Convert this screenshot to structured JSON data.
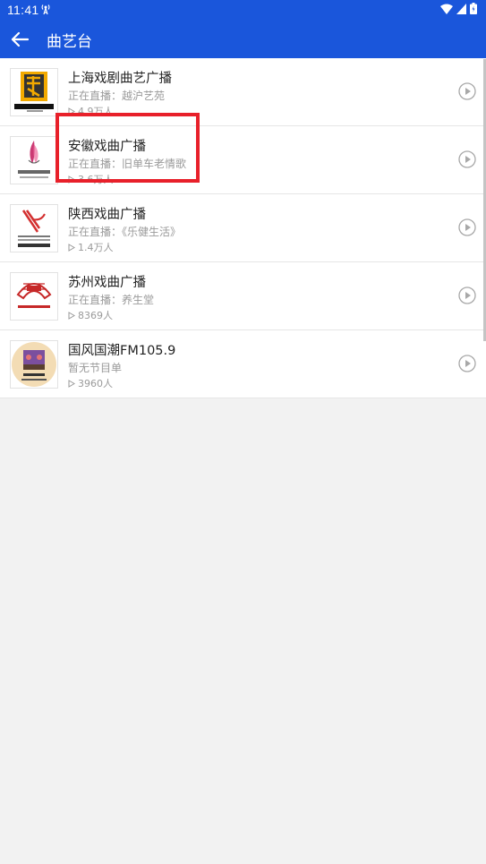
{
  "status_bar": {
    "time": "11:41"
  },
  "app_bar": {
    "title": "曲艺台"
  },
  "stations": [
    {
      "name": "上海戏剧曲艺广播",
      "program": "正在直播：越沪艺苑",
      "listeners": "4.9万人",
      "logo_text": "上海戏曲广播"
    },
    {
      "name": "安徽戏曲广播",
      "program": "正在直播：旧单车老情歌",
      "listeners": "3.6万人",
      "logo_text": "安徽戏曲广播"
    },
    {
      "name": "陕西戏曲广播",
      "program": "正在直播：《乐健生活》",
      "listeners": "1.4万人",
      "logo_text": "陕西戏曲广播"
    },
    {
      "name": "苏州戏曲广播",
      "program": "正在直播：养生堂",
      "listeners": "8369人",
      "logo_text": "苏州戏曲广播"
    },
    {
      "name": "国风国潮FM105.9",
      "program": "暂无节目单",
      "listeners": "3960人",
      "logo_text": "FM105.9"
    }
  ],
  "colors": {
    "primary": "#1a56db",
    "highlight": "#e8202a"
  }
}
